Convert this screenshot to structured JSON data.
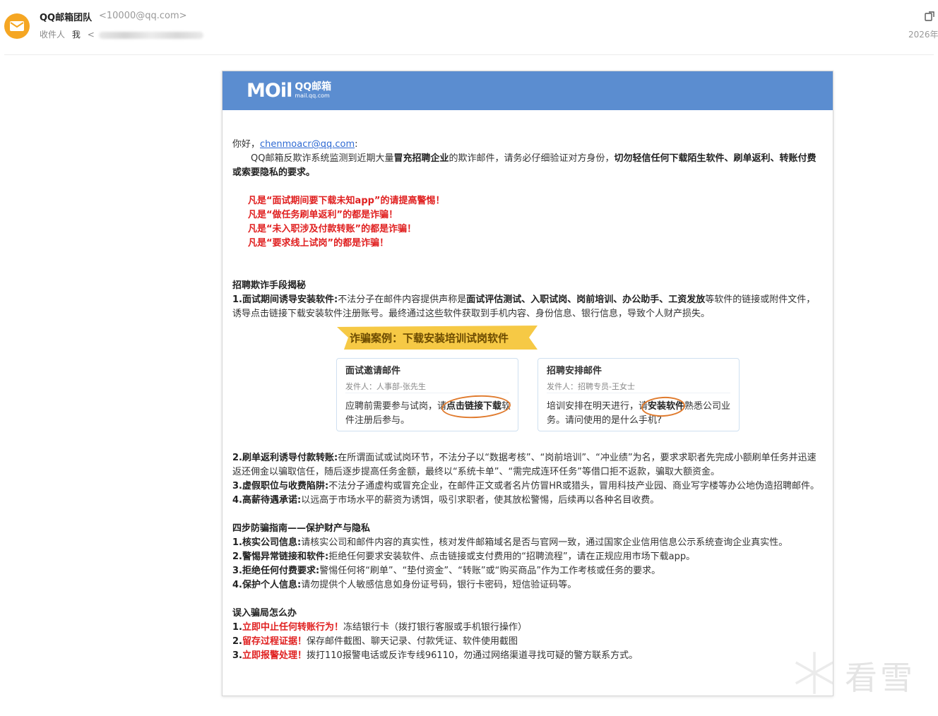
{
  "header": {
    "sender_name": "QQ邮箱团队",
    "sender_addr": "<10000@qq.com>",
    "recipients_label": "收件人",
    "recipient_me": "我",
    "recipient_addr_prefix": "<",
    "date": "2026年",
    "accent_color": "#f5a623"
  },
  "banner": {
    "logo_text": "MOil",
    "logo_cn": "QQ邮箱",
    "logo_domain": "mail.qq.com",
    "color": "#5b8dd0"
  },
  "email": {
    "greeting": "你好，",
    "greeting_addr": "chenmoacr@qq.com",
    "greeting_colon": ":",
    "intro_1": "QQ邮箱反欺诈系统监测到近期大量",
    "intro_b1": "冒充招聘企业",
    "intro_2": "的欺诈邮件，请务必仔细验证对方身份，",
    "intro_b2": "切勿轻信任何下载陌生软件、刷单返利、转账付费或索要隐私的要求。",
    "warnings": [
      "凡是“面试期间要下载未知app”的请提高警惕！",
      "凡是“做任务刷单返利”的都是诈骗！",
      "凡是“未入职涉及付款转账”的都是诈骗！",
      "凡是“要求线上试岗”的都是诈骗！"
    ],
    "sec1_title": "招聘欺诈手段揭秘",
    "m1_b": "1.面试期间诱导安装软件:",
    "m1_t1": "不法分子在邮件内容提供声称是",
    "m1_b2": "面试评估测试、入职试岗、岗前培训、办公助手、工资发放",
    "m1_t2": "等软件的链接或附件文件，诱导点击链接下载安装软件注册账号。最终通过这些软件获取到手机内容、身份信息、银行信息，导致个人财产损失。",
    "case": {
      "ribbon": "诈骗案例：下载安装培训试岗软件",
      "card1": {
        "title": "面试邀请邮件",
        "from": "发件人：人事部-张先生",
        "body_1": "应聘前需要参与试岗，请",
        "body_hl": "点击链接下载",
        "body_2": "软件注册后参与。"
      },
      "card2": {
        "title": "招聘安排邮件",
        "from": "发件人：招聘专员-王女士",
        "body_1": "培训安排在明天进行，请",
        "body_hl": "安装软件",
        "body_2": "熟悉公司业务。请问使用的是什么手机?"
      }
    },
    "m2_b": "2.刷单返利诱导付款转账:",
    "m2_t": "在所谓面试或试岗环节，不法分子以“数据考核”、“岗前培训”、“冲业绩”为名，要求求职者先完成小额刷单任务并迅速返还佣金以骗取信任，随后逐步提高任务金额，最终以“系统卡单”、“需完成连环任务”等借口拒不返款，骗取大额资金。",
    "m3_b": "3.虚假职位与收费陷阱:",
    "m3_t": "不法分子通虚构或冒充企业，在邮件正文或者名片仿冒HR或猎头，冒用科技产业园、商业写字楼等办公地伪造招聘邮件。",
    "m4_b": "4.高薪待遇承诺:",
    "m4_t": "以远高于市场水平的薪资为诱饵，吸引求职者，使其放松警惕，后续再以各种名目收费。",
    "sec2_title": "四步防骗指南——保护财产与隐私",
    "g1_b": "1.核实公司信息:",
    "g1_t": "请核实公司和邮件内容的真实性，核对发件邮箱域名是否与官网一致，通过国家企业信用信息公示系统查询企业真实性。",
    "g2_b": "2.警惕异常链接和软件:",
    "g2_t": "拒绝任何要求安装软件、点击链接或支付费用的“招聘流程”，请在正规应用市场下载app。",
    "g3_b": "3.拒绝任何付费要求:",
    "g3_t": "警惕任何将“刷单”、“垫付资金”、“转账”或“购买商品”作为工作考核或任务的要求。",
    "g4_b": "4.保护个人信息:",
    "g4_t": "请勿提供个人敏感信息如身份证号码，银行卡密码，短信验证码等。",
    "sec3_title": "误入骗局怎么办",
    "s1_n": "1.",
    "s1_r": "立即中止任何转账行为！",
    "s1_t": "冻结银行卡（拨打银行客服或手机银行操作）",
    "s2_n": "2.",
    "s2_r": "留存过程证据！",
    "s2_t": "保存邮件截图、聊天记录、付款凭证、软件使用截图",
    "s3_n": "3.",
    "s3_r": "立即报警处理！",
    "s3_t": "拨打110报警电话或反诈专线96110，勿通过网络渠道寻找可疑的警方联系方式。"
  },
  "watermark": {
    "text": "看雪"
  }
}
